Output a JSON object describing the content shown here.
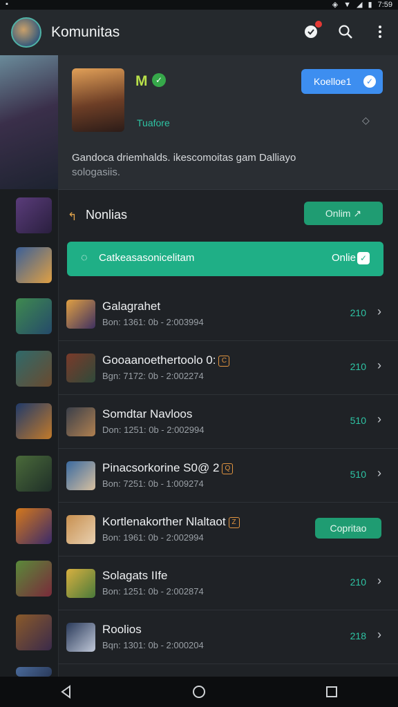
{
  "status_bar": {
    "time": "7:59",
    "left_icon": "notification-icon",
    "right_icons": [
      "location-icon",
      "wifi-icon",
      "signal-icon",
      "battery-icon"
    ]
  },
  "app_bar": {
    "title": "Komunitas",
    "actions": [
      {
        "name": "notifications-icon"
      },
      {
        "name": "search-icon"
      },
      {
        "name": "more-vert-icon"
      }
    ]
  },
  "profile": {
    "name": "M",
    "name_icon": "verified-icon",
    "subtitle": "Tuafore",
    "follow_label": "Koelloe1",
    "description": "Gandoca driemhalds. ikescomoitas gam Dalliayo",
    "description_more": "sologasiis."
  },
  "news": {
    "title": "Nonlias",
    "online_label": "Onlim",
    "banner_text": "Catkeasasonicelitam",
    "banner_status": "Onlie"
  },
  "list": [
    {
      "title": "Galagrahet",
      "tag": "",
      "meta": "Bon: 1361: 0b - 2:003994",
      "count": "210",
      "action": ""
    },
    {
      "title": "Gooaanoethertoolo 0:",
      "tag": "C",
      "meta": "Bgn: 7172: 0b - 2:002274",
      "count": "210",
      "action": ""
    },
    {
      "title": "Somdtar Navloos",
      "tag": "",
      "meta": "Don: 1251: 0b - 2:002994",
      "count": "510",
      "action": ""
    },
    {
      "title": "Pinacsorkorine S0@ 2",
      "tag": "Q",
      "meta": "Bon: 7251: 0b - 1:009274",
      "count": "510",
      "action": ""
    },
    {
      "title": "Kortlenakorther Nlaltaot",
      "tag": "Z",
      "meta": "Bon: 1961: 0b - 2:002994",
      "count": "",
      "action": "Copritao"
    },
    {
      "title": "Solagats IIfe",
      "tag": "",
      "meta": "Bon: 1251: 0b - 2:002874",
      "count": "210",
      "action": ""
    },
    {
      "title": "Roolios",
      "tag": "",
      "meta": "Bqn: 1301: 0b - 2:000204",
      "count": "218",
      "action": ""
    }
  ],
  "sidebar_thumbs": [
    "game-1",
    "game-2",
    "game-3",
    "game-4",
    "game-5",
    "game-6",
    "game-7",
    "game-8",
    "game-9"
  ],
  "nav": [
    {
      "name": "back-icon"
    },
    {
      "name": "home-icon"
    },
    {
      "name": "recents-icon"
    }
  ]
}
